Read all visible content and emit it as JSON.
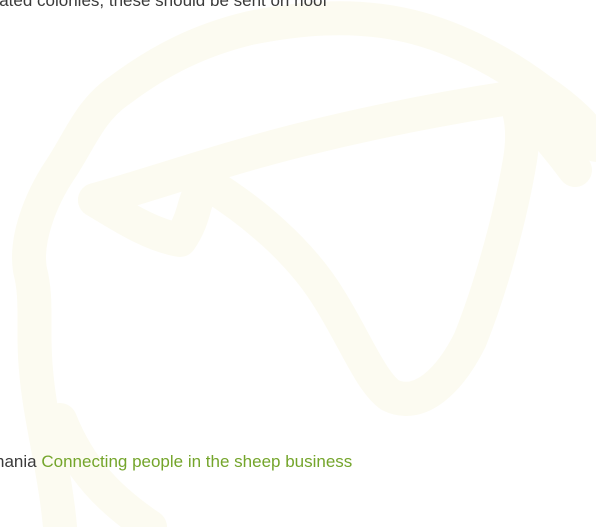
{
  "content": {
    "body_text_fragment": "plated colonies, these should be sent on hoof"
  },
  "footer": {
    "org_name_fragment": "nania",
    "tagline": "Connecting people in the sheep business"
  },
  "colors": {
    "background": "#ffffff",
    "body_text": "#3a3a3a",
    "tagline_green": "#74a52b",
    "watermark": "#fcfbf1"
  },
  "watermark": {
    "icon": "sheep-outline-icon"
  }
}
